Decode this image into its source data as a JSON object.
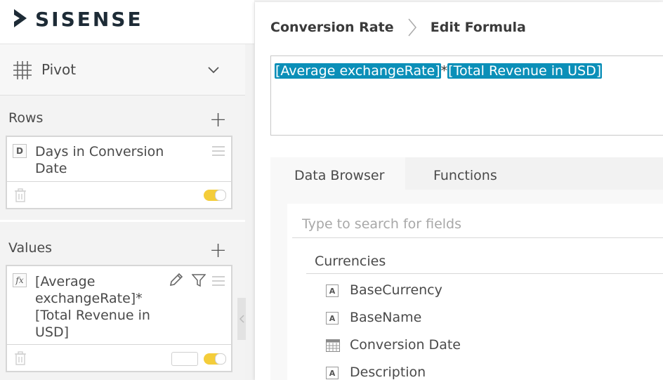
{
  "app": {
    "logo_text": "SISENSE"
  },
  "panel": {
    "pivot_label": "Pivot",
    "rows": {
      "title": "Rows",
      "field": {
        "badge": "D",
        "label_line1": "Days in Conversion",
        "label_line2": "Date"
      }
    },
    "values": {
      "title": "Values",
      "field": {
        "badge": "fx",
        "label_line1": "[Average",
        "label_line2": "exchangeRate]*",
        "label_line3": "[Total Revenue in",
        "label_line4": "USD]"
      }
    }
  },
  "formula": {
    "breadcrumb": {
      "parent": "Conversion Rate",
      "current": "Edit Formula"
    },
    "tokens": [
      "[Average exchangeRate]",
      "[Total Revenue in USD]"
    ],
    "operator": "*"
  },
  "tabs": [
    {
      "label": "Data Browser",
      "active": true
    },
    {
      "label": "Functions",
      "active": false
    }
  ],
  "browser": {
    "search_placeholder": "Type to search for fields",
    "group": "Currencies",
    "fields": [
      {
        "label": "BaseCurrency",
        "icon": "text-field-icon"
      },
      {
        "label": "BaseName",
        "icon": "text-field-icon"
      },
      {
        "label": "Conversion Date",
        "icon": "date-field-icon"
      },
      {
        "label": "Description",
        "icon": "text-field-icon"
      }
    ]
  },
  "colors": {
    "accent": "#0b8fb8",
    "toggle": "#f4cd3a"
  }
}
